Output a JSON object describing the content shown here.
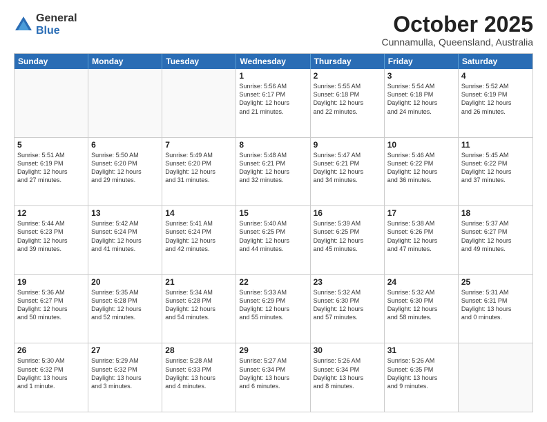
{
  "logo": {
    "general": "General",
    "blue": "Blue"
  },
  "title": "October 2025",
  "location": "Cunnamulla, Queensland, Australia",
  "days_of_week": [
    "Sunday",
    "Monday",
    "Tuesday",
    "Wednesday",
    "Thursday",
    "Friday",
    "Saturday"
  ],
  "weeks": [
    [
      {
        "day": "",
        "text": ""
      },
      {
        "day": "",
        "text": ""
      },
      {
        "day": "",
        "text": ""
      },
      {
        "day": "1",
        "text": "Sunrise: 5:56 AM\nSunset: 6:17 PM\nDaylight: 12 hours\nand 21 minutes."
      },
      {
        "day": "2",
        "text": "Sunrise: 5:55 AM\nSunset: 6:18 PM\nDaylight: 12 hours\nand 22 minutes."
      },
      {
        "day": "3",
        "text": "Sunrise: 5:54 AM\nSunset: 6:18 PM\nDaylight: 12 hours\nand 24 minutes."
      },
      {
        "day": "4",
        "text": "Sunrise: 5:52 AM\nSunset: 6:19 PM\nDaylight: 12 hours\nand 26 minutes."
      }
    ],
    [
      {
        "day": "5",
        "text": "Sunrise: 5:51 AM\nSunset: 6:19 PM\nDaylight: 12 hours\nand 27 minutes."
      },
      {
        "day": "6",
        "text": "Sunrise: 5:50 AM\nSunset: 6:20 PM\nDaylight: 12 hours\nand 29 minutes."
      },
      {
        "day": "7",
        "text": "Sunrise: 5:49 AM\nSunset: 6:20 PM\nDaylight: 12 hours\nand 31 minutes."
      },
      {
        "day": "8",
        "text": "Sunrise: 5:48 AM\nSunset: 6:21 PM\nDaylight: 12 hours\nand 32 minutes."
      },
      {
        "day": "9",
        "text": "Sunrise: 5:47 AM\nSunset: 6:21 PM\nDaylight: 12 hours\nand 34 minutes."
      },
      {
        "day": "10",
        "text": "Sunrise: 5:46 AM\nSunset: 6:22 PM\nDaylight: 12 hours\nand 36 minutes."
      },
      {
        "day": "11",
        "text": "Sunrise: 5:45 AM\nSunset: 6:22 PM\nDaylight: 12 hours\nand 37 minutes."
      }
    ],
    [
      {
        "day": "12",
        "text": "Sunrise: 5:44 AM\nSunset: 6:23 PM\nDaylight: 12 hours\nand 39 minutes."
      },
      {
        "day": "13",
        "text": "Sunrise: 5:42 AM\nSunset: 6:24 PM\nDaylight: 12 hours\nand 41 minutes."
      },
      {
        "day": "14",
        "text": "Sunrise: 5:41 AM\nSunset: 6:24 PM\nDaylight: 12 hours\nand 42 minutes."
      },
      {
        "day": "15",
        "text": "Sunrise: 5:40 AM\nSunset: 6:25 PM\nDaylight: 12 hours\nand 44 minutes."
      },
      {
        "day": "16",
        "text": "Sunrise: 5:39 AM\nSunset: 6:25 PM\nDaylight: 12 hours\nand 45 minutes."
      },
      {
        "day": "17",
        "text": "Sunrise: 5:38 AM\nSunset: 6:26 PM\nDaylight: 12 hours\nand 47 minutes."
      },
      {
        "day": "18",
        "text": "Sunrise: 5:37 AM\nSunset: 6:27 PM\nDaylight: 12 hours\nand 49 minutes."
      }
    ],
    [
      {
        "day": "19",
        "text": "Sunrise: 5:36 AM\nSunset: 6:27 PM\nDaylight: 12 hours\nand 50 minutes."
      },
      {
        "day": "20",
        "text": "Sunrise: 5:35 AM\nSunset: 6:28 PM\nDaylight: 12 hours\nand 52 minutes."
      },
      {
        "day": "21",
        "text": "Sunrise: 5:34 AM\nSunset: 6:28 PM\nDaylight: 12 hours\nand 54 minutes."
      },
      {
        "day": "22",
        "text": "Sunrise: 5:33 AM\nSunset: 6:29 PM\nDaylight: 12 hours\nand 55 minutes."
      },
      {
        "day": "23",
        "text": "Sunrise: 5:32 AM\nSunset: 6:30 PM\nDaylight: 12 hours\nand 57 minutes."
      },
      {
        "day": "24",
        "text": "Sunrise: 5:32 AM\nSunset: 6:30 PM\nDaylight: 12 hours\nand 58 minutes."
      },
      {
        "day": "25",
        "text": "Sunrise: 5:31 AM\nSunset: 6:31 PM\nDaylight: 13 hours\nand 0 minutes."
      }
    ],
    [
      {
        "day": "26",
        "text": "Sunrise: 5:30 AM\nSunset: 6:32 PM\nDaylight: 13 hours\nand 1 minute."
      },
      {
        "day": "27",
        "text": "Sunrise: 5:29 AM\nSunset: 6:32 PM\nDaylight: 13 hours\nand 3 minutes."
      },
      {
        "day": "28",
        "text": "Sunrise: 5:28 AM\nSunset: 6:33 PM\nDaylight: 13 hours\nand 4 minutes."
      },
      {
        "day": "29",
        "text": "Sunrise: 5:27 AM\nSunset: 6:34 PM\nDaylight: 13 hours\nand 6 minutes."
      },
      {
        "day": "30",
        "text": "Sunrise: 5:26 AM\nSunset: 6:34 PM\nDaylight: 13 hours\nand 8 minutes."
      },
      {
        "day": "31",
        "text": "Sunrise: 5:26 AM\nSunset: 6:35 PM\nDaylight: 13 hours\nand 9 minutes."
      },
      {
        "day": "",
        "text": ""
      }
    ]
  ]
}
